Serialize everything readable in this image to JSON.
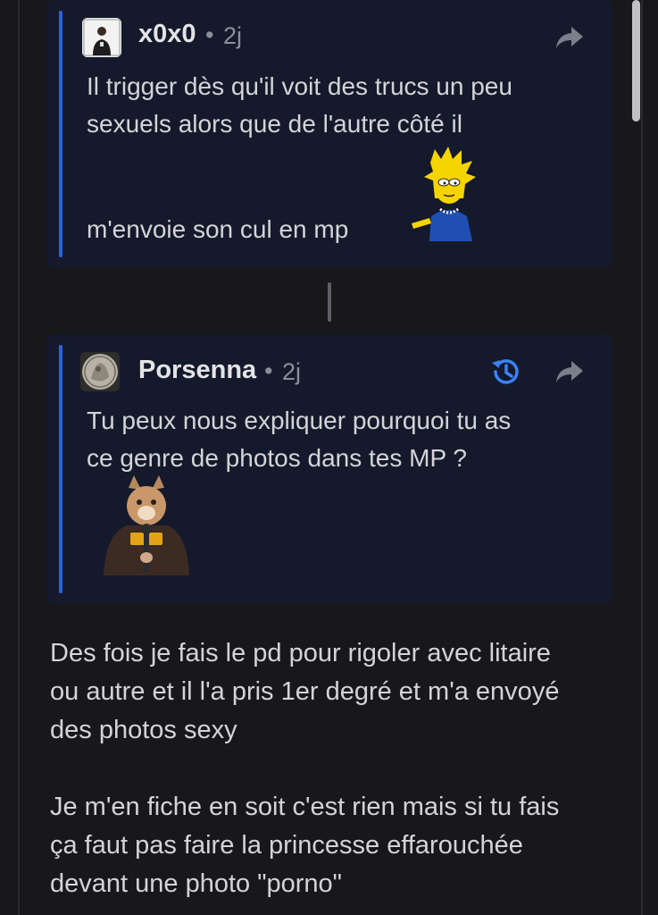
{
  "quotes": [
    {
      "author": "x0x0",
      "separator": "•",
      "time": "2j",
      "lines": [
        "Il trigger dès qu'il voit des trucs un peu",
        "sexuels alors que de l'autre côté il",
        "m'envoie son cul en mp"
      ]
    },
    {
      "author": "Porsenna",
      "separator": "•",
      "time": "2j",
      "lines": [
        "Tu peux nous expliquer pourquoi tu as",
        "ce genre de photos dans tes MP ?"
      ]
    }
  ],
  "message": {
    "paragraph1": [
      "Des fois je fais le pd pour rigoler avec litaire",
      "ou autre et il l'a pris 1er degré et m'a envoyé",
      "des photos sexy"
    ],
    "paragraph2": [
      "Je m'en fiche en soit c'est rien mais si tu fais",
      "ça faut pas faire la princesse effarouchée",
      "devant une photo \"porno\""
    ]
  },
  "colors": {
    "background": "#18181b",
    "card": "#141a2b",
    "accent": "#2563eb",
    "history": "#3b82f6"
  },
  "icons": {
    "share": "share-arrow-icon",
    "history": "history-icon"
  }
}
